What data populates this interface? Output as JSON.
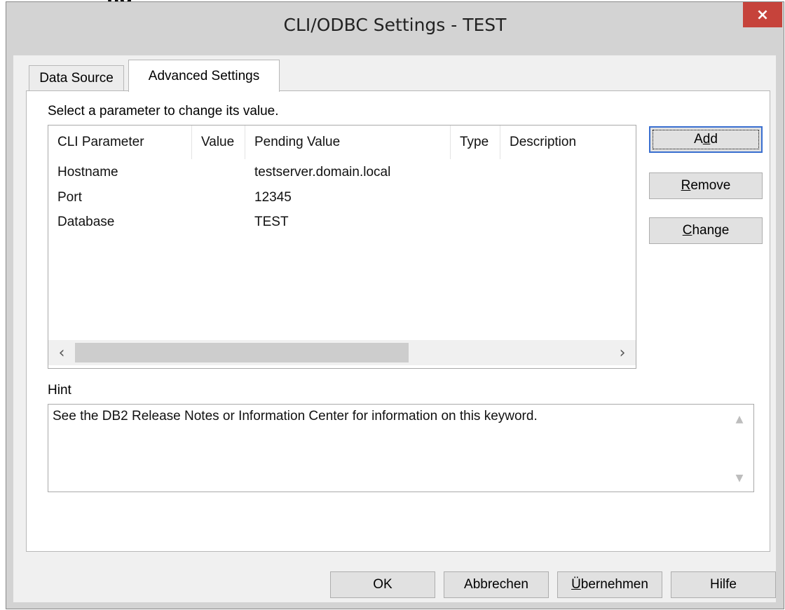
{
  "window": {
    "title": "CLI/ODBC Settings - TEST",
    "close_glyph": "×",
    "top_cut_text": "ng"
  },
  "tabs": [
    {
      "label": "Data Source",
      "active": false
    },
    {
      "label": "Advanced Settings",
      "active": true
    }
  ],
  "advanced": {
    "instruction": "Select a parameter to change its value.",
    "columns": [
      "CLI Parameter",
      "Value",
      "Pending Value",
      "Type",
      "Description"
    ],
    "rows": [
      {
        "parameter": "Hostname",
        "value": "",
        "pending": "testserver.domain.local",
        "type": "",
        "description": ""
      },
      {
        "parameter": "Port",
        "value": "",
        "pending": "12345",
        "type": "",
        "description": ""
      },
      {
        "parameter": "Database",
        "value": "",
        "pending": "TEST",
        "type": "",
        "description": ""
      }
    ],
    "scroll_left_glyph": "‹",
    "scroll_right_glyph": "›",
    "buttons": {
      "add": {
        "pre": "A",
        "ul": "d",
        "post": "d"
      },
      "remove": {
        "pre": "",
        "ul": "R",
        "post": "emove"
      },
      "change": {
        "pre": "",
        "ul": "C",
        "post": "hange"
      }
    },
    "hint_label": "Hint",
    "hint_text": "See the DB2 Release Notes or Information Center for information on this keyword.",
    "hint_up_glyph": "▲",
    "hint_down_glyph": "▼"
  },
  "footer": {
    "ok": "OK",
    "cancel": "Abbrechen",
    "apply": {
      "pre": "",
      "ul": "Ü",
      "post": "bernehmen"
    },
    "help": "Hilfe"
  },
  "icons": {
    "close": "close-icon",
    "scroll_left": "chevron-left-icon",
    "scroll_right": "chevron-right-icon",
    "scroll_up": "chevron-up-icon",
    "scroll_down": "chevron-down-icon"
  },
  "colors": {
    "close_button": "#c6433b",
    "default_button_border": "#3a6fd0",
    "frame": "#d3d3d3"
  }
}
